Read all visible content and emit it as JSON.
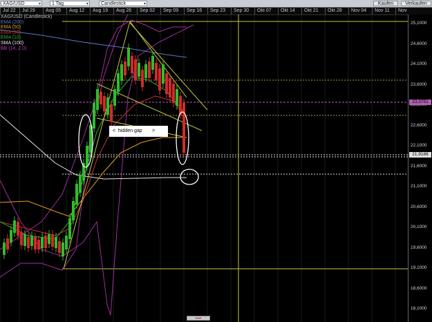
{
  "toolbar": {
    "symbol": "XAG/USD",
    "timeframe": "1 Tag",
    "chart_style": "Candlestick",
    "buy_label": "Kaufen",
    "sell_label": "Verkaufen"
  },
  "date_axis": [
    "Jul 22",
    "Jul 29",
    "Aug 05",
    "Aug 12",
    "Aug 19",
    "Aug 26",
    "Sep 02",
    "Sep 09",
    "Sep 16",
    "Sep 23",
    "Sep 30",
    "Okt 07",
    "Okt 14",
    "Okt 21",
    "Okt 28",
    "Nov 04",
    "Nov 11",
    "Nov"
  ],
  "legend": [
    {
      "text": "XAG/USD (Candlestick)",
      "color": "#c0c0c0"
    },
    {
      "text": "EMA (200)",
      "color": "#5a78c8"
    },
    {
      "text": "EMA (50)",
      "color": "#e0a020"
    },
    {
      "text": "EMA (20)",
      "color": "#c83232"
    },
    {
      "text": "EMA (10)",
      "color": "#30b030"
    },
    {
      "text": "SMA (100)",
      "color": "#e8e8e8"
    },
    {
      "text": "BB (14, 2.0)",
      "color": "#b040b0"
    }
  ],
  "price_axis": [
    "25,1000",
    "24,6000",
    "24,1000",
    "23,6000",
    "23,1000",
    "22,6000",
    "22,1000",
    "21,6000",
    "21,1000",
    "20,6000",
    "20,1000",
    "19,6000",
    "19,1000",
    "18,6000",
    "18,1000"
  ],
  "price_badges": [
    {
      "value": "23,3751",
      "color": "#b060b0"
    },
    {
      "value": "21,9186",
      "color": "#e0e0e0"
    }
  ],
  "annotation": {
    "left_char": "<",
    "text": "hidden gap",
    "right_char": ">"
  },
  "bottom_widget": "▪▪▪▪▪",
  "colors": {
    "bull": "#2ebd2e",
    "bear": "#d42a2a",
    "background": "#000000"
  }
}
